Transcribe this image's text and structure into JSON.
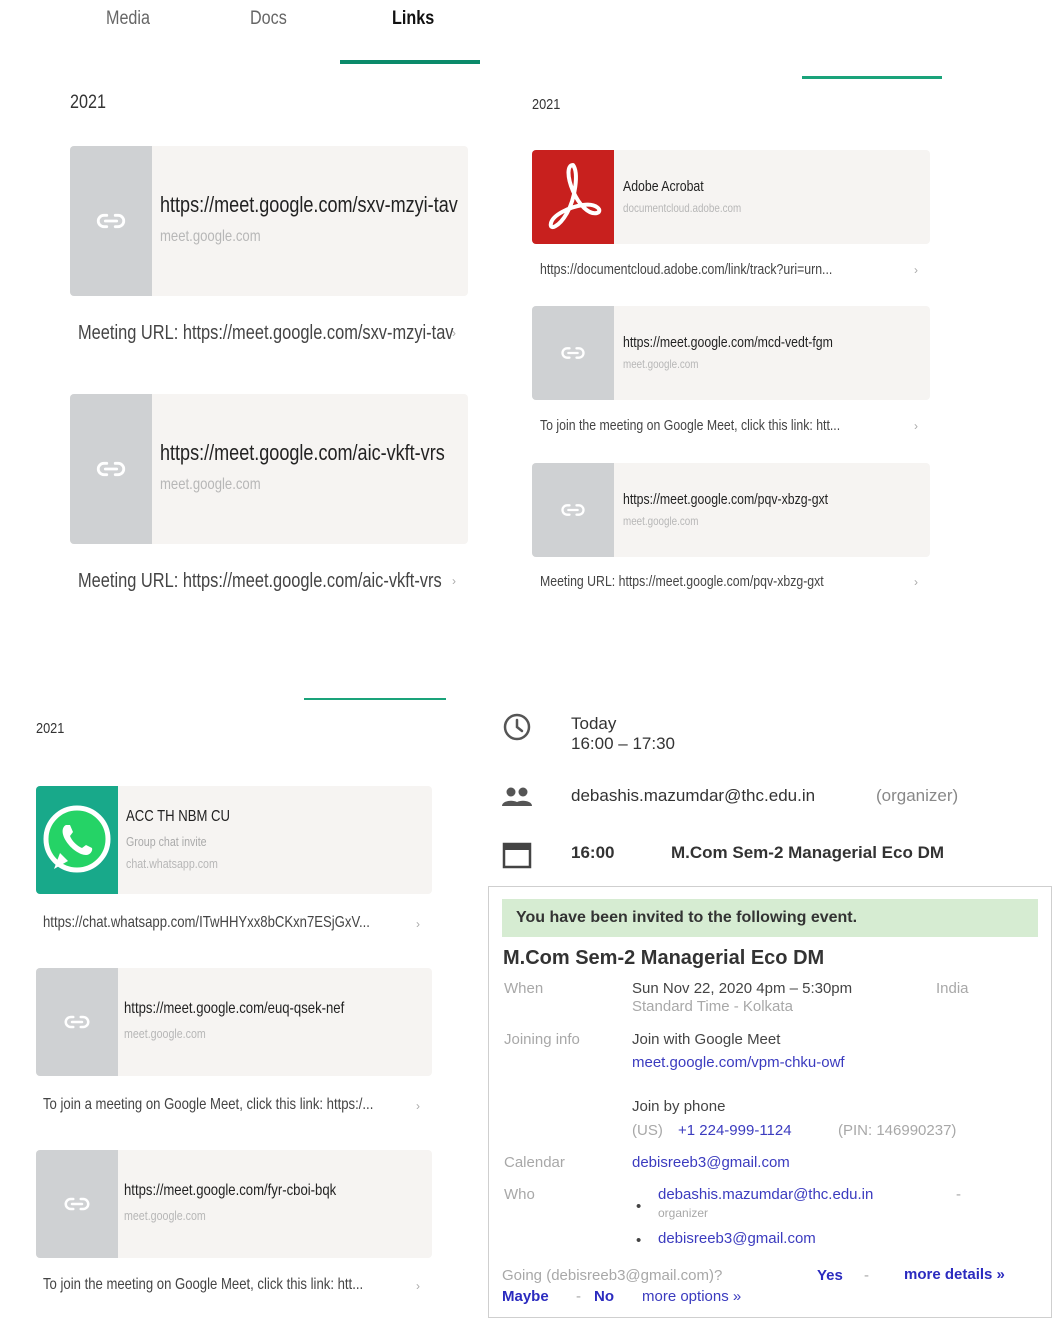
{
  "tabs": [
    {
      "label": "Media"
    },
    {
      "label": "Docs"
    },
    {
      "label": "Links"
    }
  ],
  "colors": {
    "accent": "#0b8a6a",
    "thumb_grey": "#cfd1d3",
    "card_bg": "#f6f4f2",
    "adobe_red": "#c8201e",
    "whatsapp_green": "#25b76d",
    "invite_green": "#d6ecd2",
    "link_blue": "#3b3bbf"
  },
  "panel1": {
    "year": "2021",
    "links": [
      {
        "title": "https://meet.google.com/sxv-mzyi-tav",
        "domain": "meet.google.com",
        "caption": "Meeting URL: https://meet.google.com/sxv-mzyi-tav",
        "icon": "link-icon"
      },
      {
        "title": "https://meet.google.com/aic-vkft-vrs",
        "domain": "meet.google.com",
        "caption": "Meeting URL: https://meet.google.com/aic-vkft-vrs",
        "icon": "link-icon"
      }
    ]
  },
  "panel2": {
    "year": "2021",
    "links": [
      {
        "title": "Adobe Acrobat",
        "domain": "documentcloud.adobe.com",
        "caption": "https://documentcloud.adobe.com/link/track?uri=urn...",
        "icon": "adobe-acrobat-icon"
      },
      {
        "title": "https://meet.google.com/mcd-vedt-fgm",
        "domain": "meet.google.com",
        "caption": "To join the meeting on Google Meet, click this link: htt...",
        "icon": "link-icon"
      },
      {
        "title": "https://meet.google.com/pqv-xbzg-gxt",
        "domain": "meet.google.com",
        "caption": "Meeting URL: https://meet.google.com/pqv-xbzg-gxt",
        "icon": "link-icon"
      }
    ]
  },
  "panel3": {
    "year": "2021",
    "links": [
      {
        "title": "ACC TH NBM CU",
        "subtitle": "Group chat invite",
        "domain": "chat.whatsapp.com",
        "caption": "https://chat.whatsapp.com/ITwHHYxx8bCKxn7ESjGxV...",
        "icon": "whatsapp-icon"
      },
      {
        "title": "https://meet.google.com/euq-qsek-nef",
        "domain": "meet.google.com",
        "caption": "To join a meeting on Google Meet, click this link: https:/...",
        "icon": "link-icon"
      },
      {
        "title": "https://meet.google.com/fyr-cboi-bqk",
        "domain": "meet.google.com",
        "caption": "To join the meeting on Google Meet, click this link: htt...",
        "icon": "link-icon"
      }
    ]
  },
  "event": {
    "day": "Today",
    "time_range": "16:00 – 17:30",
    "organizer_email": "debashis.mazumdar@thc.edu.in",
    "organizer_role": "(organizer)",
    "start_time": "16:00",
    "title": "M.Com Sem-2 Managerial Eco DM"
  },
  "invite": {
    "banner": "You have been invited to the following event.",
    "title": "M.Com Sem-2 Managerial Eco DM",
    "when_label": "When",
    "when_value": "Sun Nov 22, 2020 4pm – 5:30pm",
    "when_tz1": "India",
    "when_tz2": "Standard Time - Kolkata",
    "joining_label": "Joining info",
    "join_meet_text": "Join with Google Meet",
    "join_meet_link": "meet.google.com/vpm-chku-owf",
    "join_phone_text": "Join by phone",
    "phone_country": "(US)",
    "phone_number": "+1 224-999-1124",
    "phone_pin": "(PIN: 146990237)",
    "calendar_label": "Calendar",
    "calendar_value": "debisreeb3@gmail.com",
    "who_label": "Who",
    "who_1": "debashis.mazumdar@thc.edu.in",
    "who_1_dash": "-",
    "who_1_role": "organizer",
    "who_2": "debisreeb3@gmail.com",
    "going_prefix": "Going (debisreeb3@gmail.com)?",
    "yes": "Yes",
    "maybe": "Maybe",
    "no": "No",
    "sep": "-",
    "more_options": "more options »",
    "more_details": "more details »"
  }
}
